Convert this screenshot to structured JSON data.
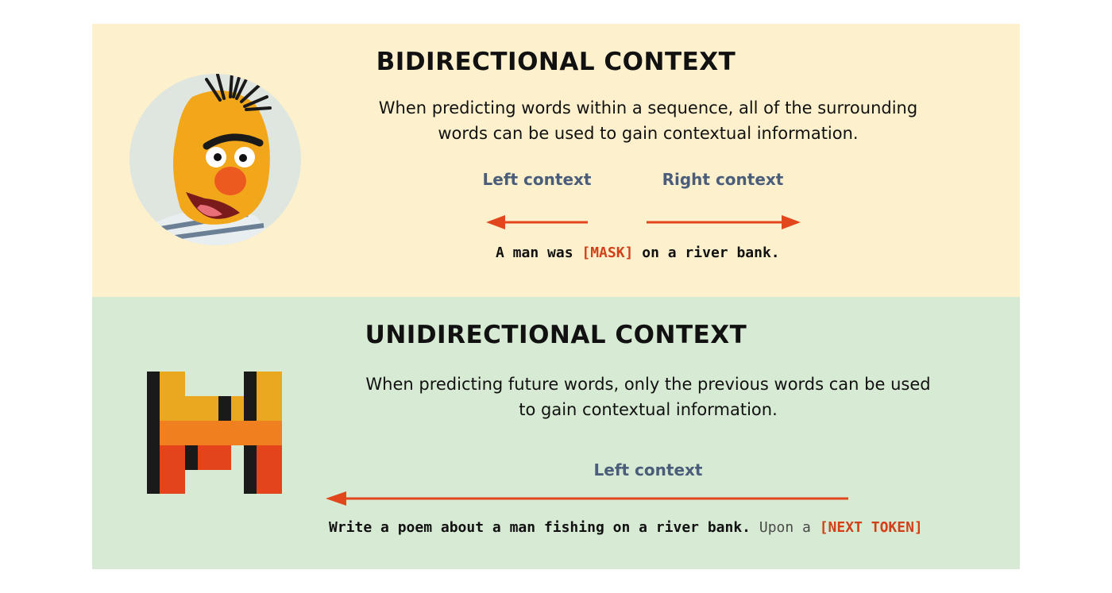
{
  "bidirectional": {
    "title": "BIDIRECTIONAL CONTEXT",
    "description_line1": "When predicting words within a sequence, all of the surrounding",
    "description_line2": "words can be used to gain contextual information.",
    "left_label": "Left context",
    "right_label": "Right context",
    "sentence_before": "A man was ",
    "sentence_mask": "[MASK]",
    "sentence_after": " on a river bank.",
    "icon": "bert-muppet-avatar"
  },
  "unidirectional": {
    "title": "UNIDIRECTIONAL CONTEXT",
    "description_line1": "When predicting future words, only the previous words can be used",
    "description_line2": "to gain contextual information.",
    "left_label": "Left context",
    "sentence_prompt": "Write a poem about a man fishing on a river bank.",
    "sentence_continuation": " Upon a ",
    "sentence_next": "[NEXT TOKEN]",
    "icon": "mistral-logo"
  },
  "colors": {
    "top_background": "#fdf0cc",
    "bottom_background": "#d7ead3",
    "arrow": "#e2461d",
    "label": "#4a5d7a",
    "mask": "#d2401a"
  }
}
